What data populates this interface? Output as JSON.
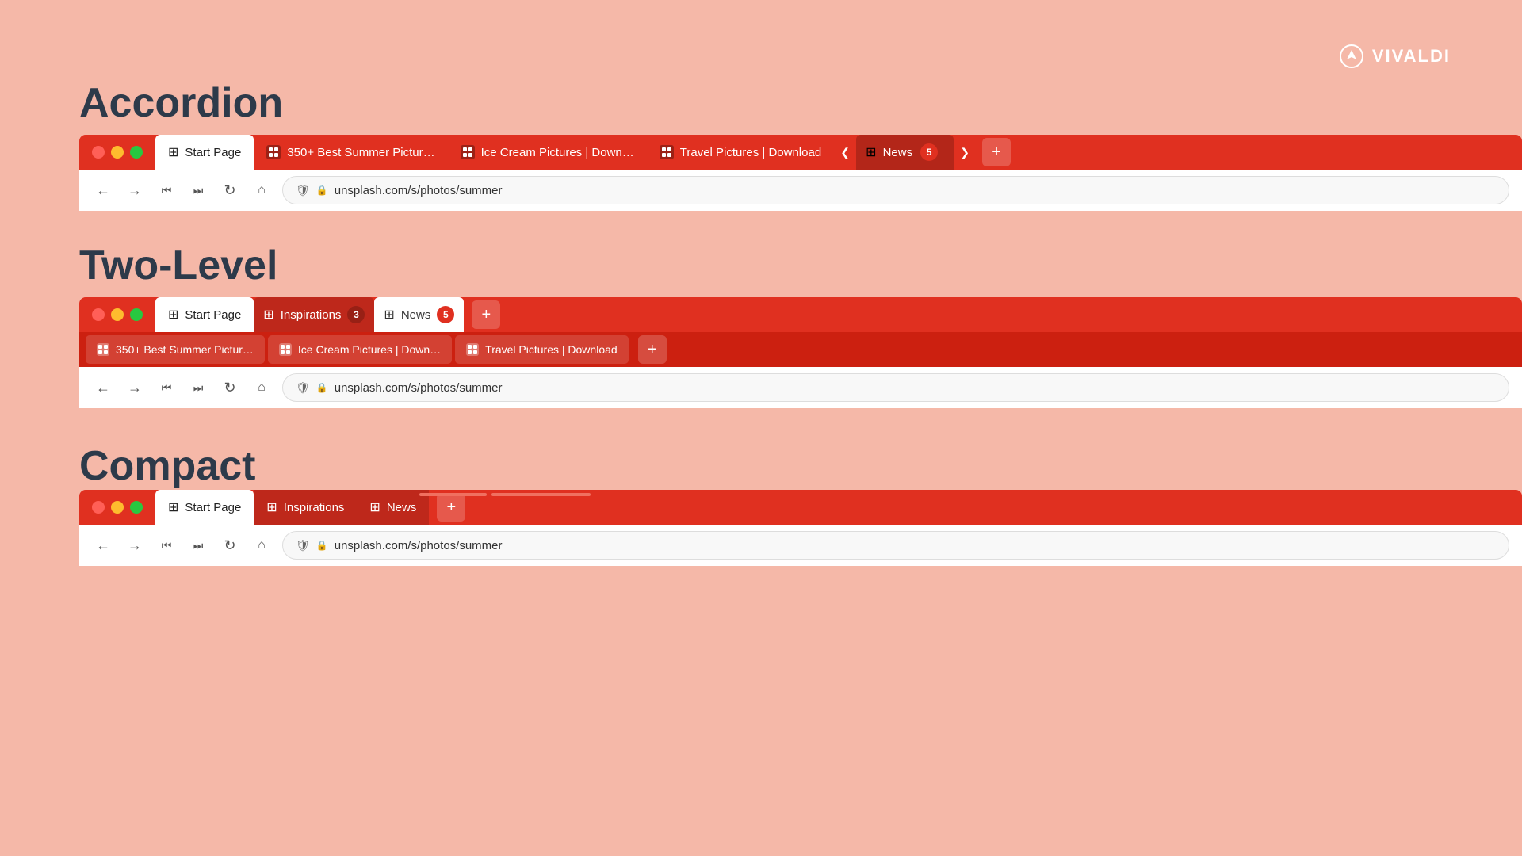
{
  "brand": {
    "name": "VIVALDI"
  },
  "sections": {
    "accordion": {
      "title": "Accordion"
    },
    "two_level": {
      "title": "Two-Level"
    },
    "compact": {
      "title": "Compact"
    }
  },
  "accordion": {
    "tabs": [
      {
        "id": "start",
        "label": "Start Page",
        "type": "active"
      },
      {
        "id": "summer",
        "label": "350+ Best Summer Pictur…",
        "type": "inactive"
      },
      {
        "id": "icecream",
        "label": "Ice Cream Pictures | Down…",
        "type": "inactive"
      },
      {
        "id": "travel",
        "label": "Travel Pictures | Download",
        "type": "inactive"
      }
    ],
    "group": {
      "label": "News",
      "count": "5"
    },
    "url": "unsplash.com/s/photos/summer"
  },
  "two_level": {
    "groups": [
      {
        "label": "Start Page",
        "type": "start"
      },
      {
        "label": "Inspirations",
        "count": "3",
        "type": "inactive"
      },
      {
        "label": "News",
        "count": "5",
        "type": "active"
      }
    ],
    "sub_tabs": [
      {
        "label": "350+ Best Summer Pictur…"
      },
      {
        "label": "Ice Cream Pictures | Down…"
      },
      {
        "label": "Travel Pictures | Download"
      }
    ],
    "url": "unsplash.com/s/photos/summer"
  },
  "compact": {
    "groups": [
      {
        "label": "Start Page",
        "type": "start"
      },
      {
        "label": "Inspirations",
        "type": "inactive"
      },
      {
        "label": "News",
        "type": "active"
      }
    ],
    "indicators": [
      {
        "width": 80,
        "color": "#ff7060"
      },
      {
        "width": 120,
        "color": "#ff7060"
      }
    ],
    "url": "unsplash.com/s/photos/summer"
  },
  "icons": {
    "grid": "⊞",
    "tab_icon": "▣",
    "back": "←",
    "forward": "→",
    "first": "⏮",
    "last": "⏭",
    "reload": "↻",
    "home": "⌂",
    "shield": "🛡",
    "lock": "🔒",
    "plus": "+",
    "chevron_left": "❮",
    "chevron_right": "❯"
  }
}
